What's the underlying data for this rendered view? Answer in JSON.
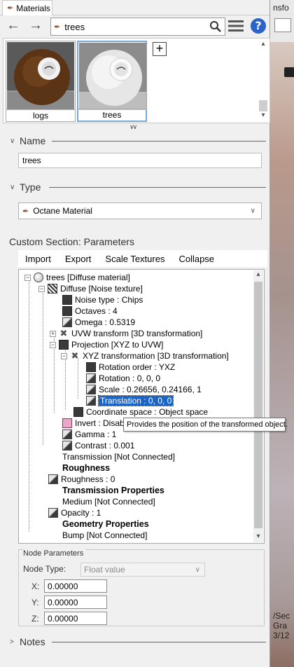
{
  "panel": {
    "tab_label": "Materials",
    "search_value": "trees"
  },
  "materials": [
    {
      "name": "logs"
    },
    {
      "name": "trees"
    }
  ],
  "sections": {
    "name_label": "Name",
    "name_value": "trees",
    "type_label": "Type",
    "type_value": "Octane Material",
    "custom_title": "Custom Section: Parameters"
  },
  "actions": [
    "Import",
    "Export",
    "Scale Textures",
    "Collapse"
  ],
  "tree": [
    {
      "label": "trees  [Diffuse material]"
    },
    {
      "label": "Diffuse  [Noise texture]"
    },
    {
      "label": "Noise type : Chips"
    },
    {
      "label": "Octaves : 4"
    },
    {
      "label": "Omega : 0.5319"
    },
    {
      "label": "UVW transform  [3D transformation]"
    },
    {
      "label": "Projection  [XYZ to UVW]"
    },
    {
      "label": "XYZ transformation  [3D transformation]"
    },
    {
      "label": "Rotation order : YXZ"
    },
    {
      "label": "Rotation : 0, 0, 0"
    },
    {
      "label": "Scale : 0.26656, 0.24166, 1"
    },
    {
      "label": "Translation : 0, 0, 0"
    },
    {
      "label": "Coordinate space : Object space"
    },
    {
      "label": "Invert : Disable"
    },
    {
      "label": "Gamma : 1"
    },
    {
      "label": "Contrast : 0.001"
    },
    {
      "label": "Transmission  [Not Connected]"
    },
    {
      "label": "Roughness"
    },
    {
      "label": "Roughness : 0"
    },
    {
      "label": "Transmission Properties"
    },
    {
      "label": "Medium  [Not Connected]"
    },
    {
      "label": "Opacity : 1"
    },
    {
      "label": "Geometry Properties"
    },
    {
      "label": "Bump  [Not Connected]"
    }
  ],
  "tooltip": "Provides the position of the transformed object.",
  "node_params": {
    "title": "Node Parameters",
    "type_label": "Node Type:",
    "type_value": "Float value",
    "x_label": "X:",
    "y_label": "Y:",
    "z_label": "Z:",
    "x_value": "0.00000",
    "y_value": "0.00000",
    "z_value": "0.00000"
  },
  "notes_label": "Notes",
  "background_fragments": [
    "nsfo",
    "/Sec",
    "Gra",
    "3/12"
  ]
}
